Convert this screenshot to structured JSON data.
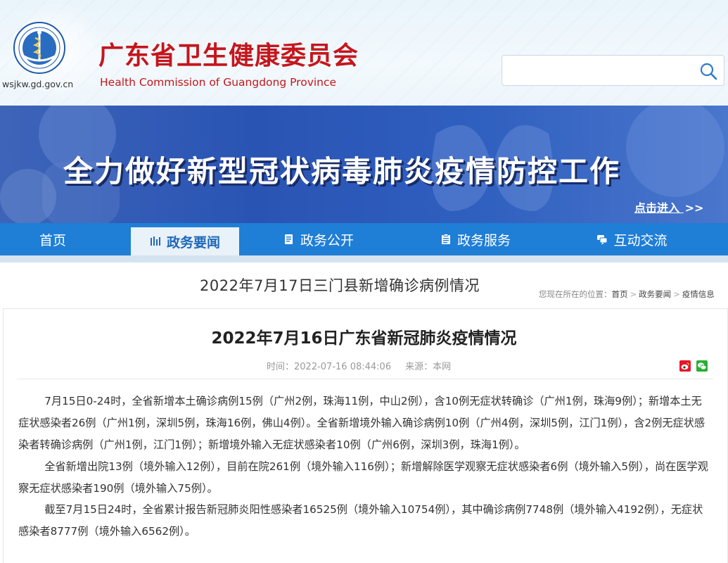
{
  "header": {
    "domain": "wsjkw.gd.gov.cn",
    "org_name_cn": "广东省卫生健康委员会",
    "org_name_en": "Health Commission of Guangdong Province",
    "logo_icon": "health-commission-emblem-icon",
    "search": {
      "value": "",
      "placeholder": "",
      "icon": "search-icon"
    },
    "colors": {
      "brand_red": "#c5161d",
      "nav_blue": "#1f7ed6"
    }
  },
  "banner": {
    "title": "全力做好新型冠状病毒肺炎疫情防控工作",
    "link_text": "点击进入",
    "link_arrows": ">>"
  },
  "nav": {
    "items": [
      {
        "label": "首页",
        "icon": ""
      },
      {
        "label": "政务要闻",
        "icon": "list-icon",
        "active": true
      },
      {
        "label": "政务公开",
        "icon": "document-icon"
      },
      {
        "label": "政务服务",
        "icon": "clipboard-icon"
      },
      {
        "label": "互动交流",
        "icon": "chat-icon"
      }
    ]
  },
  "overlay_headline": "2022年7月17日三门县新增确诊病例情况",
  "breadcrumb": {
    "prefix": "您现在所在的位置：",
    "items": [
      "首页",
      "政务要闻",
      "疫情信息"
    ]
  },
  "article": {
    "title": "2022年7月16日广东省新冠肺炎疫情情况",
    "time_label": "时间：",
    "time_value": "2022-07-16 08:44:06",
    "source_label": "来源：",
    "source_value": "本网",
    "share_icons": [
      "weibo-icon",
      "wechat-icon"
    ],
    "paragraphs": [
      "7月15日0-24时，全省新增本土确诊病例15例（广州2例，珠海11例，中山2例），含10例无症状转确诊（广州1例，珠海9例）；新增本土无症状感染者26例（广州1例，深圳5例，珠海16例，佛山4例）。全省新增境外输入确诊病例10例（广州4例，深圳5例，江门1例），含2例无症状感染者转确诊病例（广州1例，江门1例）；新增境外输入无症状感染者10例（广州6例，深圳3例，珠海1例）。",
      "全省新增出院13例（境外输入12例），目前在院261例（境外输入116例）；新增解除医学观察无症状感染者6例（境外输入5例），尚在医学观察无症状感染者190例（境外输入75例）。",
      "截至7月15日24时，全省累计报告新冠肺炎阳性感染者16525例（境外输入10754例），其中确诊病例7748例（境外输入4192例），无症状感染者8777例（境外输入6562例）。"
    ]
  }
}
